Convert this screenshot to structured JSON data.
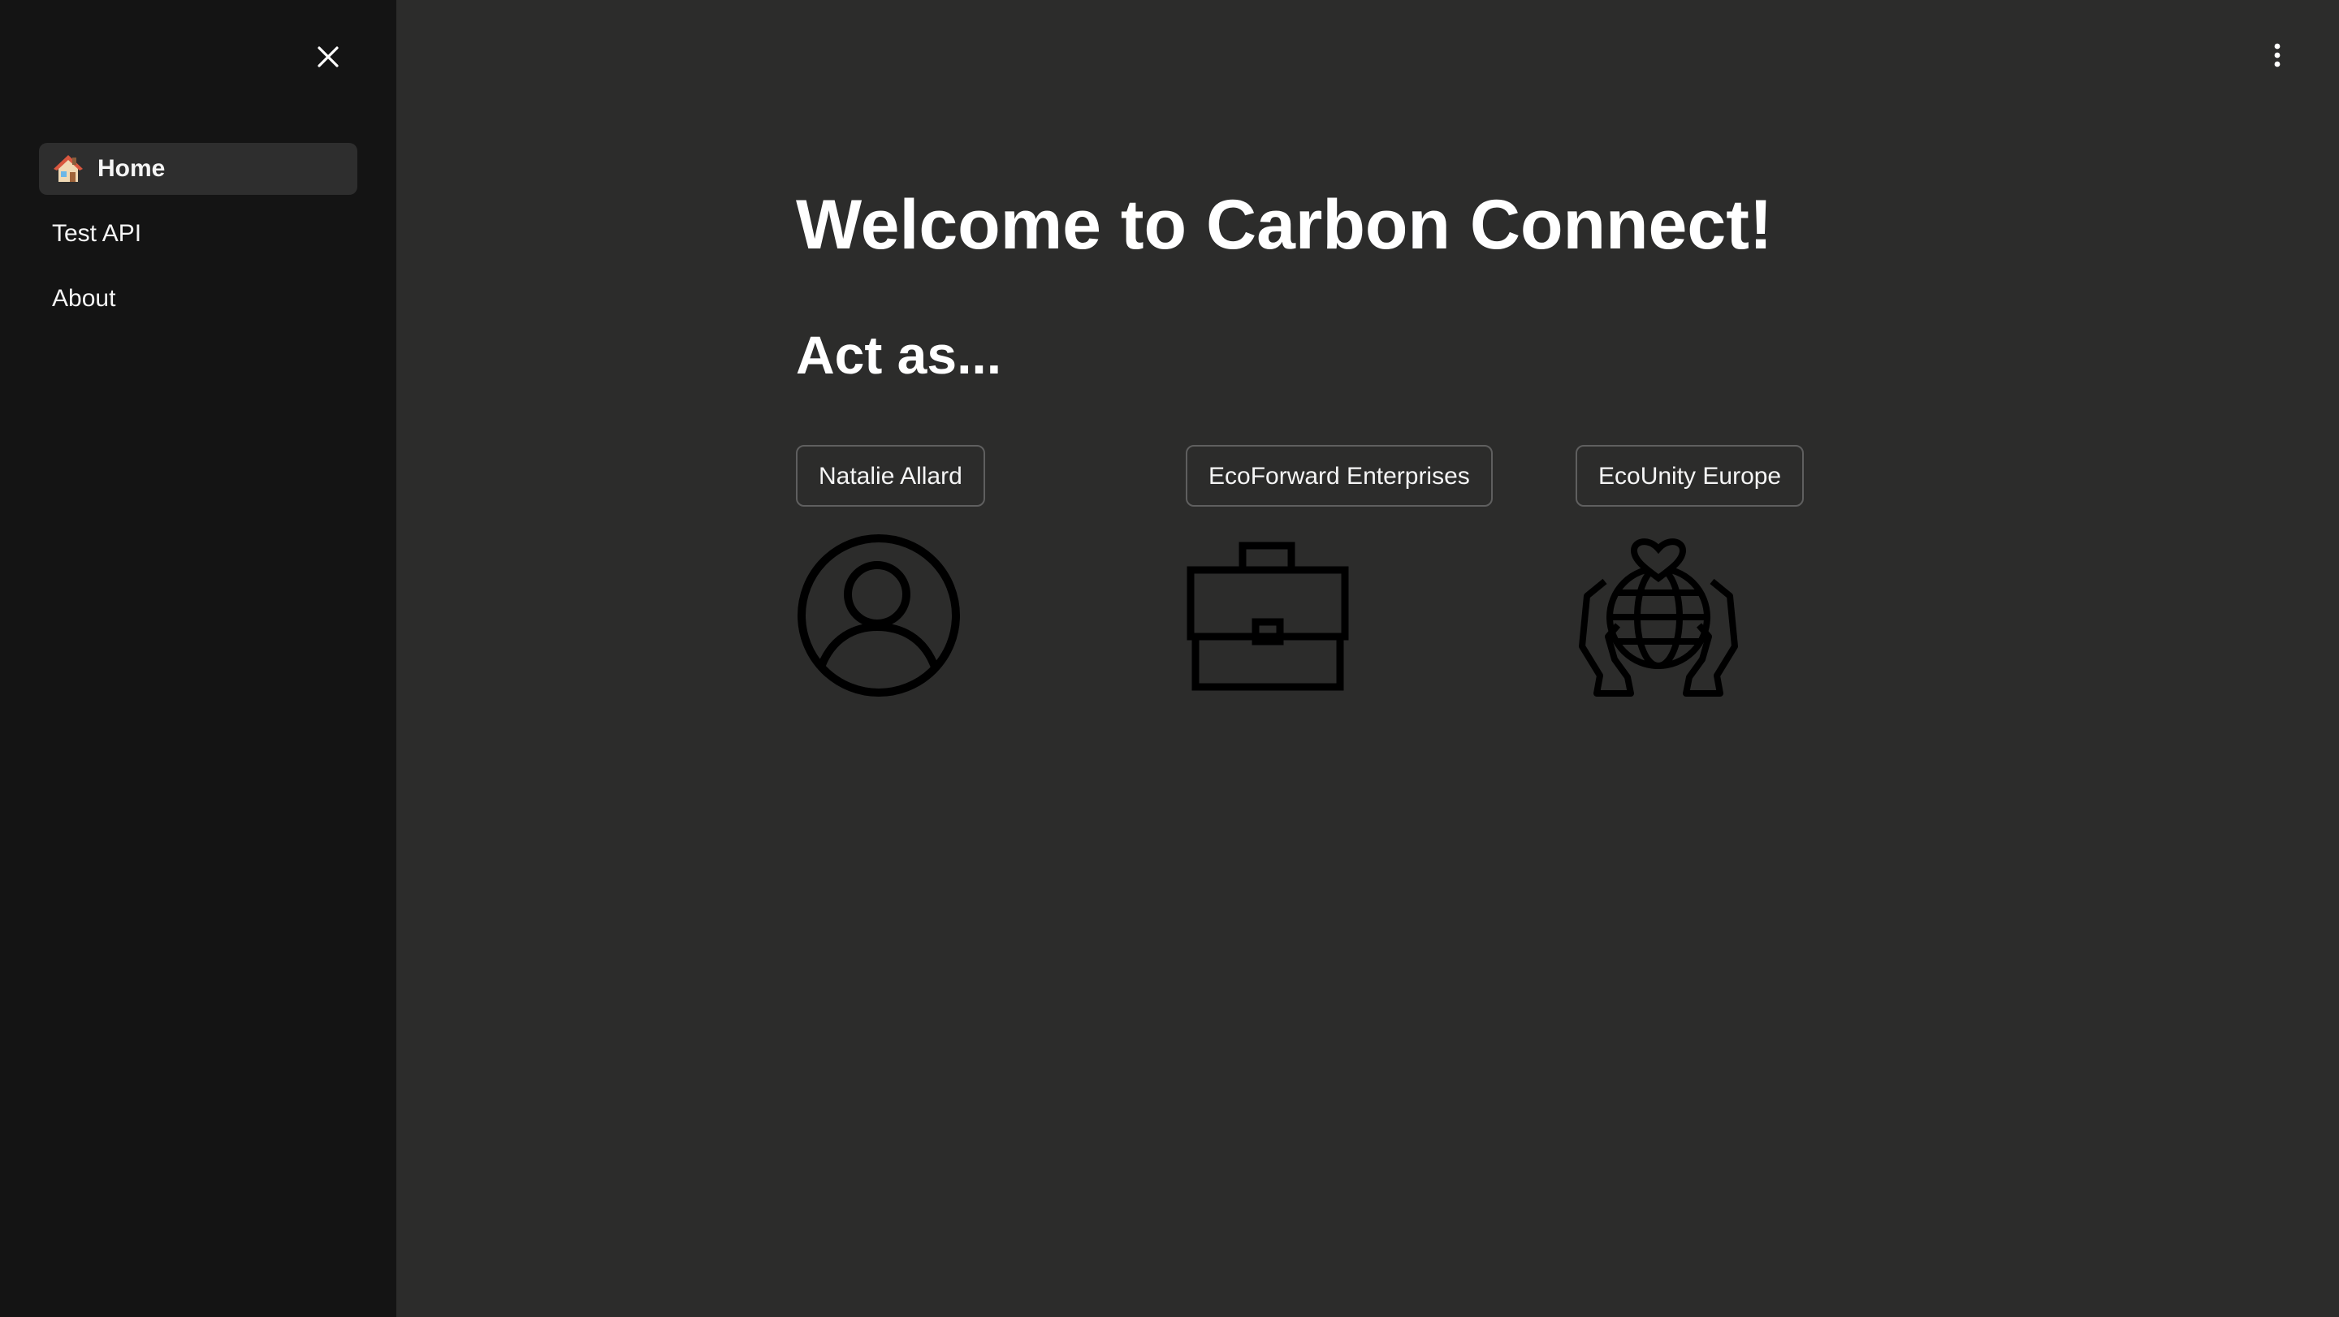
{
  "sidebar": {
    "close_icon": "close-icon",
    "items": [
      {
        "label": "Home",
        "icon": "house-emoji-icon",
        "active": true
      },
      {
        "label": "Test API",
        "active": false
      },
      {
        "label": "About",
        "active": false
      }
    ]
  },
  "header": {
    "menu_icon": "vertical-ellipsis-icon"
  },
  "main": {
    "title": "Welcome to Carbon Connect!",
    "subtitle": "Act as...",
    "roles": [
      {
        "label": "Natalie Allard",
        "icon": "user-circle-icon"
      },
      {
        "label": "EcoForward Enterprises",
        "icon": "briefcase-icon"
      },
      {
        "label": "EcoUnity Europe",
        "icon": "hands-globe-heart-icon"
      }
    ]
  },
  "colors": {
    "main_background": "#2c2c2b",
    "sidebar_background": "#141414",
    "active_item_background": "#2e2e2e",
    "text": "#ffffff",
    "button_border": "#5f5f5f",
    "icon_stroke": "#000000"
  }
}
